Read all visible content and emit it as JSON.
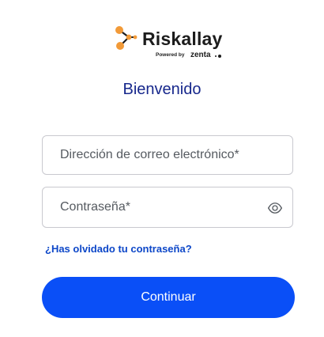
{
  "brand": {
    "name": "Riskallay",
    "powered_by": "Powered by",
    "partner": "zenta",
    "logo_color": "#f29a38"
  },
  "welcome_title": "Bienvenido",
  "form": {
    "email": {
      "placeholder": "Dirección de correo electrónico*",
      "value": ""
    },
    "password": {
      "placeholder": "Contraseña*",
      "value": "",
      "toggle_icon": "eye-icon"
    },
    "forgot_password_link": "¿Has olvidado tu contraseña?",
    "submit_label": "Continuar"
  },
  "colors": {
    "primary_button": "#0a4ff7",
    "title": "#17288c",
    "link": "#0d47c8"
  }
}
